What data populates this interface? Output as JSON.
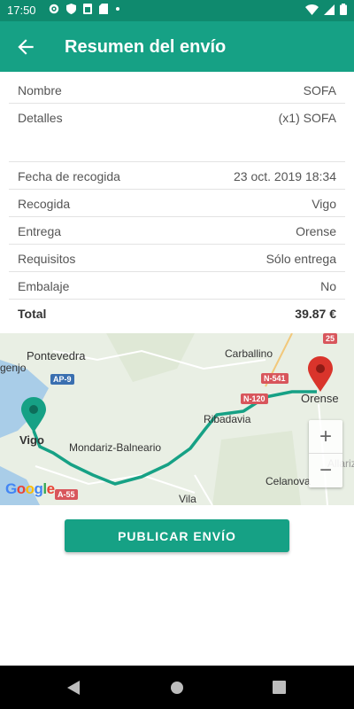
{
  "status": {
    "time": "17:50"
  },
  "appbar": {
    "title": "Resumen del envío"
  },
  "summary": {
    "rows": [
      {
        "key": "Nombre",
        "value": "SOFA"
      },
      {
        "key": "Detalles",
        "value": "(x1) SOFA"
      },
      {
        "key": "Fecha de recogida",
        "value": "23 oct. 2019 18:34"
      },
      {
        "key": "Recogida",
        "value": "Vigo"
      },
      {
        "key": "Entrega",
        "value": "Orense"
      },
      {
        "key": "Requisitos",
        "value": "Sólo entrega"
      },
      {
        "key": "Embalaje",
        "value": "No"
      },
      {
        "key": "Total",
        "value": "39.87 €"
      }
    ]
  },
  "map": {
    "labels": {
      "pontevedra": "Pontevedra",
      "carballino": "Carballino",
      "genjo": "genjo",
      "vigo": "Vigo",
      "orense": "Orense",
      "ribadavia": "Ribadavia",
      "mondariz": "Mondariz-Balneario",
      "celanova": "Celanova",
      "vila": "Vila",
      "allariz": "Allariz"
    },
    "roads": {
      "ap9": "AP-9",
      "n541": "N-541",
      "n120": "N-120",
      "a55": "A-55",
      "e25": "25"
    },
    "attribution": "Google",
    "route_color": "#16a185",
    "origin_pin_color": "#16a185",
    "dest_pin_color": "#d9342b"
  },
  "actions": {
    "publish": "PUBLICAR ENVÍO"
  },
  "colors": {
    "primary": "#16a185",
    "statusbar": "#0f8a6e"
  }
}
